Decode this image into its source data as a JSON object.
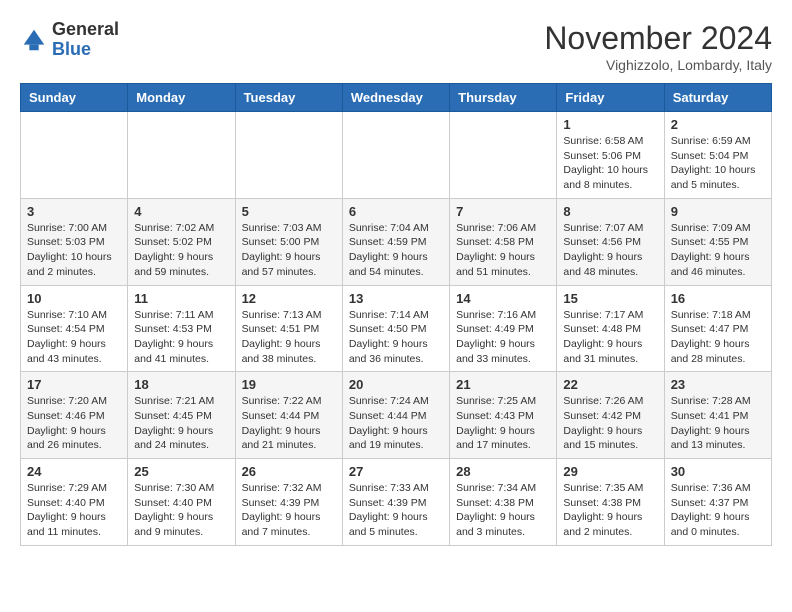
{
  "logo": {
    "line1": "General",
    "line2": "Blue",
    "icon": "▶"
  },
  "header": {
    "month": "November 2024",
    "location": "Vighizzolo, Lombardy, Italy"
  },
  "weekdays": [
    "Sunday",
    "Monday",
    "Tuesday",
    "Wednesday",
    "Thursday",
    "Friday",
    "Saturday"
  ],
  "weeks": [
    [
      {
        "day": "",
        "info": ""
      },
      {
        "day": "",
        "info": ""
      },
      {
        "day": "",
        "info": ""
      },
      {
        "day": "",
        "info": ""
      },
      {
        "day": "",
        "info": ""
      },
      {
        "day": "1",
        "info": "Sunrise: 6:58 AM\nSunset: 5:06 PM\nDaylight: 10 hours\nand 8 minutes."
      },
      {
        "day": "2",
        "info": "Sunrise: 6:59 AM\nSunset: 5:04 PM\nDaylight: 10 hours\nand 5 minutes."
      }
    ],
    [
      {
        "day": "3",
        "info": "Sunrise: 7:00 AM\nSunset: 5:03 PM\nDaylight: 10 hours\nand 2 minutes."
      },
      {
        "day": "4",
        "info": "Sunrise: 7:02 AM\nSunset: 5:02 PM\nDaylight: 9 hours\nand 59 minutes."
      },
      {
        "day": "5",
        "info": "Sunrise: 7:03 AM\nSunset: 5:00 PM\nDaylight: 9 hours\nand 57 minutes."
      },
      {
        "day": "6",
        "info": "Sunrise: 7:04 AM\nSunset: 4:59 PM\nDaylight: 9 hours\nand 54 minutes."
      },
      {
        "day": "7",
        "info": "Sunrise: 7:06 AM\nSunset: 4:58 PM\nDaylight: 9 hours\nand 51 minutes."
      },
      {
        "day": "8",
        "info": "Sunrise: 7:07 AM\nSunset: 4:56 PM\nDaylight: 9 hours\nand 48 minutes."
      },
      {
        "day": "9",
        "info": "Sunrise: 7:09 AM\nSunset: 4:55 PM\nDaylight: 9 hours\nand 46 minutes."
      }
    ],
    [
      {
        "day": "10",
        "info": "Sunrise: 7:10 AM\nSunset: 4:54 PM\nDaylight: 9 hours\nand 43 minutes."
      },
      {
        "day": "11",
        "info": "Sunrise: 7:11 AM\nSunset: 4:53 PM\nDaylight: 9 hours\nand 41 minutes."
      },
      {
        "day": "12",
        "info": "Sunrise: 7:13 AM\nSunset: 4:51 PM\nDaylight: 9 hours\nand 38 minutes."
      },
      {
        "day": "13",
        "info": "Sunrise: 7:14 AM\nSunset: 4:50 PM\nDaylight: 9 hours\nand 36 minutes."
      },
      {
        "day": "14",
        "info": "Sunrise: 7:16 AM\nSunset: 4:49 PM\nDaylight: 9 hours\nand 33 minutes."
      },
      {
        "day": "15",
        "info": "Sunrise: 7:17 AM\nSunset: 4:48 PM\nDaylight: 9 hours\nand 31 minutes."
      },
      {
        "day": "16",
        "info": "Sunrise: 7:18 AM\nSunset: 4:47 PM\nDaylight: 9 hours\nand 28 minutes."
      }
    ],
    [
      {
        "day": "17",
        "info": "Sunrise: 7:20 AM\nSunset: 4:46 PM\nDaylight: 9 hours\nand 26 minutes."
      },
      {
        "day": "18",
        "info": "Sunrise: 7:21 AM\nSunset: 4:45 PM\nDaylight: 9 hours\nand 24 minutes."
      },
      {
        "day": "19",
        "info": "Sunrise: 7:22 AM\nSunset: 4:44 PM\nDaylight: 9 hours\nand 21 minutes."
      },
      {
        "day": "20",
        "info": "Sunrise: 7:24 AM\nSunset: 4:44 PM\nDaylight: 9 hours\nand 19 minutes."
      },
      {
        "day": "21",
        "info": "Sunrise: 7:25 AM\nSunset: 4:43 PM\nDaylight: 9 hours\nand 17 minutes."
      },
      {
        "day": "22",
        "info": "Sunrise: 7:26 AM\nSunset: 4:42 PM\nDaylight: 9 hours\nand 15 minutes."
      },
      {
        "day": "23",
        "info": "Sunrise: 7:28 AM\nSunset: 4:41 PM\nDaylight: 9 hours\nand 13 minutes."
      }
    ],
    [
      {
        "day": "24",
        "info": "Sunrise: 7:29 AM\nSunset: 4:40 PM\nDaylight: 9 hours\nand 11 minutes."
      },
      {
        "day": "25",
        "info": "Sunrise: 7:30 AM\nSunset: 4:40 PM\nDaylight: 9 hours\nand 9 minutes."
      },
      {
        "day": "26",
        "info": "Sunrise: 7:32 AM\nSunset: 4:39 PM\nDaylight: 9 hours\nand 7 minutes."
      },
      {
        "day": "27",
        "info": "Sunrise: 7:33 AM\nSunset: 4:39 PM\nDaylight: 9 hours\nand 5 minutes."
      },
      {
        "day": "28",
        "info": "Sunrise: 7:34 AM\nSunset: 4:38 PM\nDaylight: 9 hours\nand 3 minutes."
      },
      {
        "day": "29",
        "info": "Sunrise: 7:35 AM\nSunset: 4:38 PM\nDaylight: 9 hours\nand 2 minutes."
      },
      {
        "day": "30",
        "info": "Sunrise: 7:36 AM\nSunset: 4:37 PM\nDaylight: 9 hours\nand 0 minutes."
      }
    ]
  ]
}
